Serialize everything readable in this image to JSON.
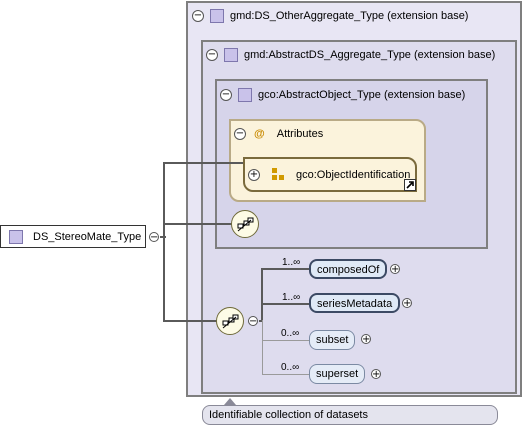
{
  "root_type": {
    "label": "DS_StereoMate_Type"
  },
  "other_aggregate": {
    "label": "gmd:DS_OtherAggregate_Type (extension base)"
  },
  "abstract_aggregate": {
    "label": "gmd:AbstractDS_Aggregate_Type (extension base)"
  },
  "abstract_object": {
    "label": "gco:AbstractObject_Type (extension base)"
  },
  "attributes": {
    "label": "Attributes",
    "at_symbol": "@"
  },
  "object_identification": {
    "label": "gco:ObjectIdentification"
  },
  "elements": [
    {
      "name": "composedOf",
      "multiplicity": "1..∞",
      "required": true
    },
    {
      "name": "seriesMetadata",
      "multiplicity": "1..∞",
      "required": true
    },
    {
      "name": "subset",
      "multiplicity": "0..∞",
      "required": false
    },
    {
      "name": "superset",
      "multiplicity": "0..∞",
      "required": false
    }
  ],
  "annotation": {
    "text": "Identifiable collection of datasets"
  },
  "icons": [
    "collapse-icon",
    "expand-icon",
    "complex-type-icon",
    "attribute-group-icon",
    "sequence-icon",
    "link-arrow-icon"
  ]
}
